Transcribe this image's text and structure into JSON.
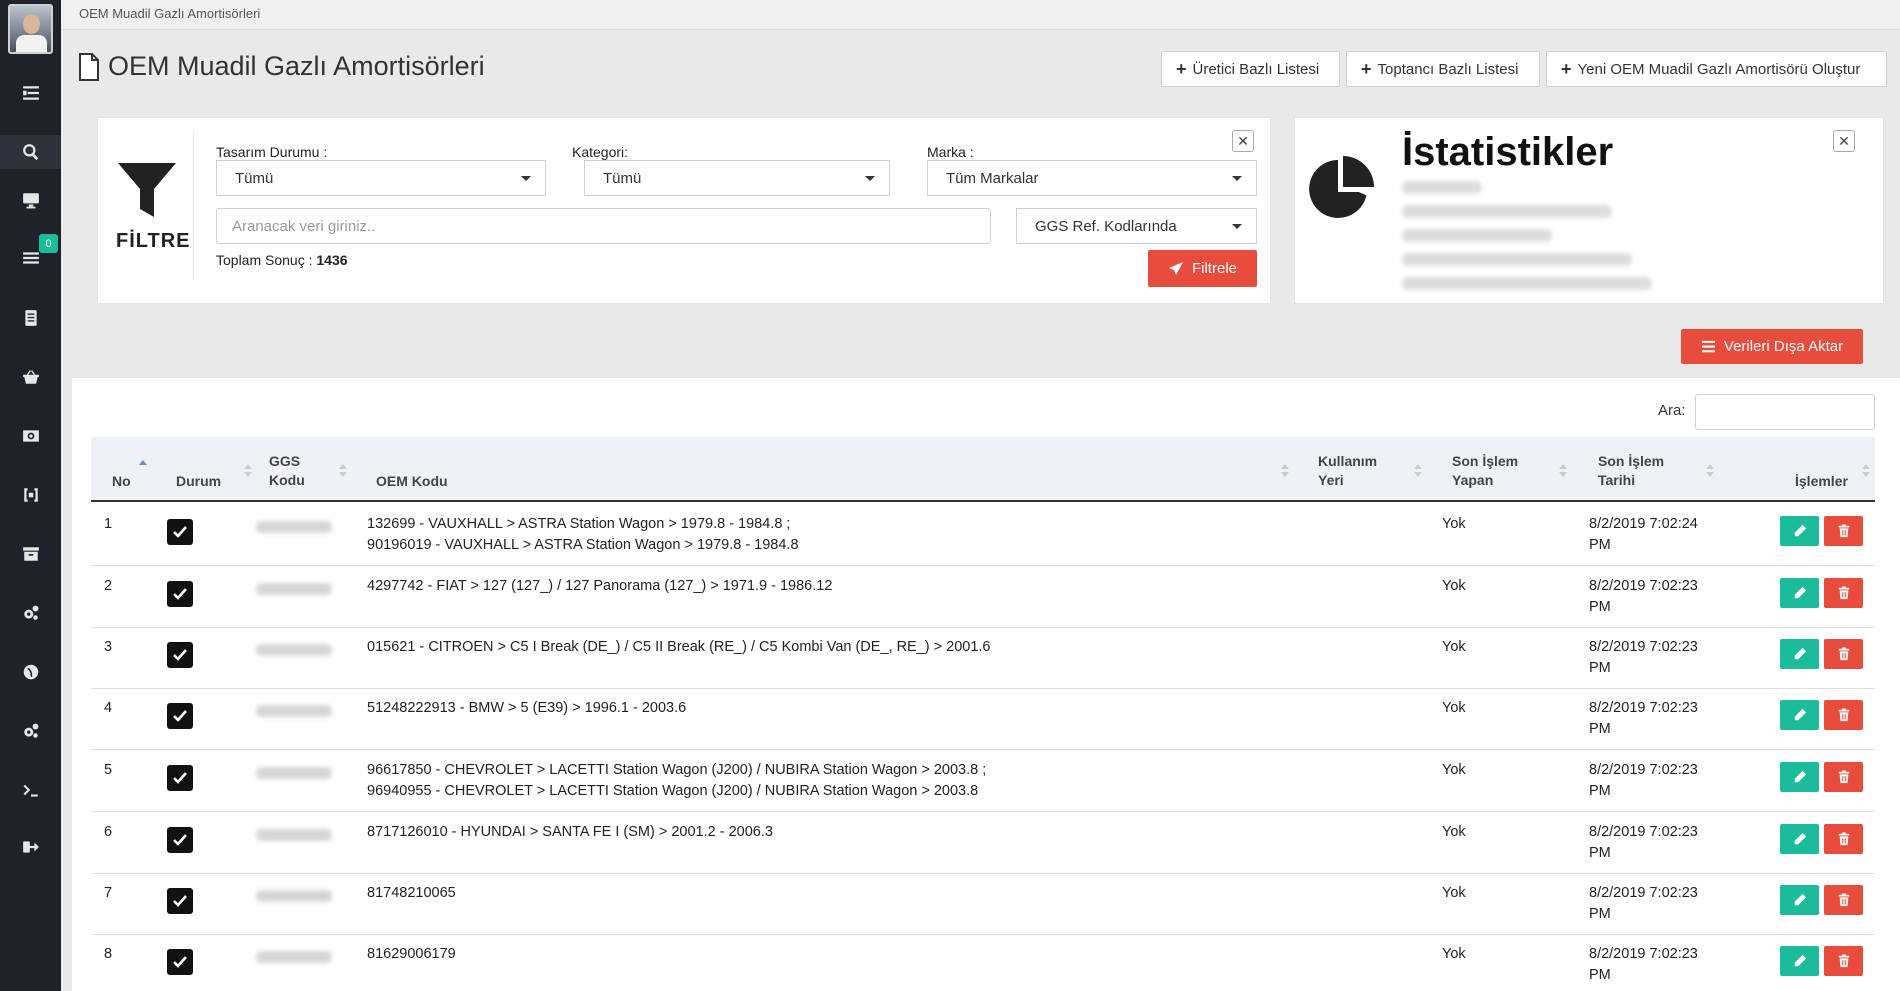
{
  "breadcrumb": "OEM Muadil Gazlı Amortisörleri",
  "page_title": "OEM Muadil Gazlı Amortisörleri",
  "header_buttons": {
    "producer_list": "Üretici Bazlı Listesi",
    "wholesaler_list": "Toptancı Bazlı Listesi",
    "create_new": "Yeni OEM Muadil Gazlı Amortisörü Oluştur"
  },
  "sidebar": {
    "badge_count": "0",
    "items": [
      "menu-icon",
      "search-icon",
      "monitor-icon",
      "list-icon",
      "document-icon",
      "basket-icon",
      "money-icon",
      "bracket-icon",
      "archive-icon",
      "gears-icon",
      "globe-icon",
      "settings-icon",
      "terminal-icon",
      "logout-icon"
    ]
  },
  "filter": {
    "heading": "FİLTRE",
    "design_status_label": "Tasarım Durumu :",
    "design_status_value": "Tümü",
    "category_label": "Kategori:",
    "category_value": "Tümü",
    "brand_label": "Marka :",
    "brand_value": "Tüm Markalar",
    "search_placeholder": "Aranacak veri giriniz..",
    "search_scope": "GGS Ref. Kodlarında",
    "total_label": "Toplam Sonuç :",
    "total_value": "1436",
    "submit_label": "Filtrele"
  },
  "stats": {
    "title": "İstatistikler"
  },
  "export_label": "Verileri Dışa Aktar",
  "search_label": "Ara:",
  "table": {
    "headers": {
      "no": "No",
      "status": "Durum",
      "ggs_1": "GGS",
      "ggs_2": "Kodu",
      "oem": "OEM Kodu",
      "usage_1": "Kullanım",
      "usage_2": "Yeri",
      "last_by_1": "Son İşlem",
      "last_by_2": "Yapan",
      "last_date_1": "Son İşlem",
      "last_date_2": "Tarihi",
      "actions": "İşlemler"
    },
    "rows": [
      {
        "no": "1",
        "oem_1": "132699 - VAUXHALL > ASTRA Station Wagon > 1979.8 - 1984.8 ;",
        "oem_2": "90196019 - VAUXHALL > ASTRA Station Wagon > 1979.8 - 1984.8",
        "by": "Yok",
        "date_1": "8/2/2019 7:02:24",
        "date_2": "PM"
      },
      {
        "no": "2",
        "oem_1": "4297742 - FIAT > 127 (127_) / 127 Panorama (127_) > 1971.9 - 1986.12",
        "oem_2": "",
        "by": "Yok",
        "date_1": "8/2/2019 7:02:23",
        "date_2": "PM"
      },
      {
        "no": "3",
        "oem_1": "015621 - CITROEN > C5 I Break (DE_) / C5 II Break (RE_) / C5 Kombi Van (DE_, RE_) > 2001.6",
        "oem_2": "",
        "by": "Yok",
        "date_1": "8/2/2019 7:02:23",
        "date_2": "PM"
      },
      {
        "no": "4",
        "oem_1": "51248222913 - BMW > 5 (E39) > 1996.1 - 2003.6",
        "oem_2": "",
        "by": "Yok",
        "date_1": "8/2/2019 7:02:23",
        "date_2": "PM"
      },
      {
        "no": "5",
        "oem_1": "96617850 - CHEVROLET > LACETTI Station Wagon (J200) / NUBIRA Station Wagon > 2003.8 ;",
        "oem_2": "96940955 - CHEVROLET > LACETTI Station Wagon (J200) / NUBIRA Station Wagon > 2003.8",
        "by": "Yok",
        "date_1": "8/2/2019 7:02:23",
        "date_2": "PM"
      },
      {
        "no": "6",
        "oem_1": "8717126010 - HYUNDAI > SANTA FE I (SM) > 2001.2 - 2006.3",
        "oem_2": "",
        "by": "Yok",
        "date_1": "8/2/2019 7:02:23",
        "date_2": "PM"
      },
      {
        "no": "7",
        "oem_1": "81748210065",
        "oem_2": "",
        "by": "Yok",
        "date_1": "8/2/2019 7:02:23",
        "date_2": "PM"
      },
      {
        "no": "8",
        "oem_1": "81629006179",
        "oem_2": "",
        "by": "Yok",
        "date_1": "8/2/2019 7:02:23",
        "date_2": "PM"
      }
    ]
  }
}
